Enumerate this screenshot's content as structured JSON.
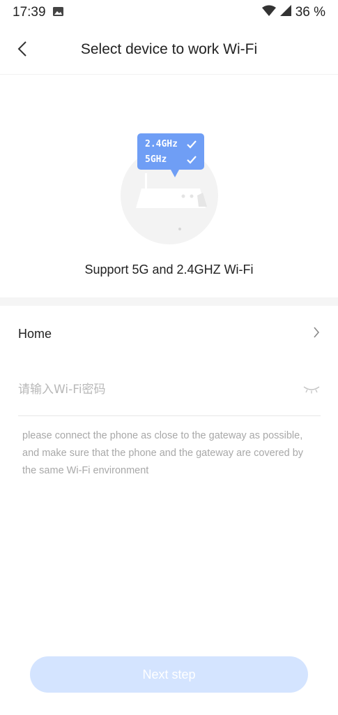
{
  "status_bar": {
    "time": "17:39",
    "battery": "36 %",
    "icons": [
      "image-icon",
      "wifi-icon",
      "signal-icon"
    ]
  },
  "header": {
    "title": "Select device to work Wi-Fi",
    "back_icon": "chevron-left-icon"
  },
  "hero": {
    "badge_line_1": "2.4GHz",
    "badge_line_2": "5GHz",
    "support_text": "Support 5G and 2.4GHZ Wi-Fi"
  },
  "network": {
    "name": "Home",
    "chevron_icon": "chevron-right-icon"
  },
  "password": {
    "value": "",
    "placeholder": "请输入Wi-Fi密码",
    "toggle_icon": "eye-closed-icon"
  },
  "hint_text": "please connect the phone as close to the gateway as possible, and make sure that the phone and the gateway are covered by the same Wi-Fi environment",
  "next_button": {
    "label": "Next step",
    "enabled": false
  },
  "colors": {
    "accent": "#6f9ef5",
    "button_disabled": "#d4e4ff",
    "placeholder": "#b8b8b8",
    "hint": "#a8a8a8"
  }
}
